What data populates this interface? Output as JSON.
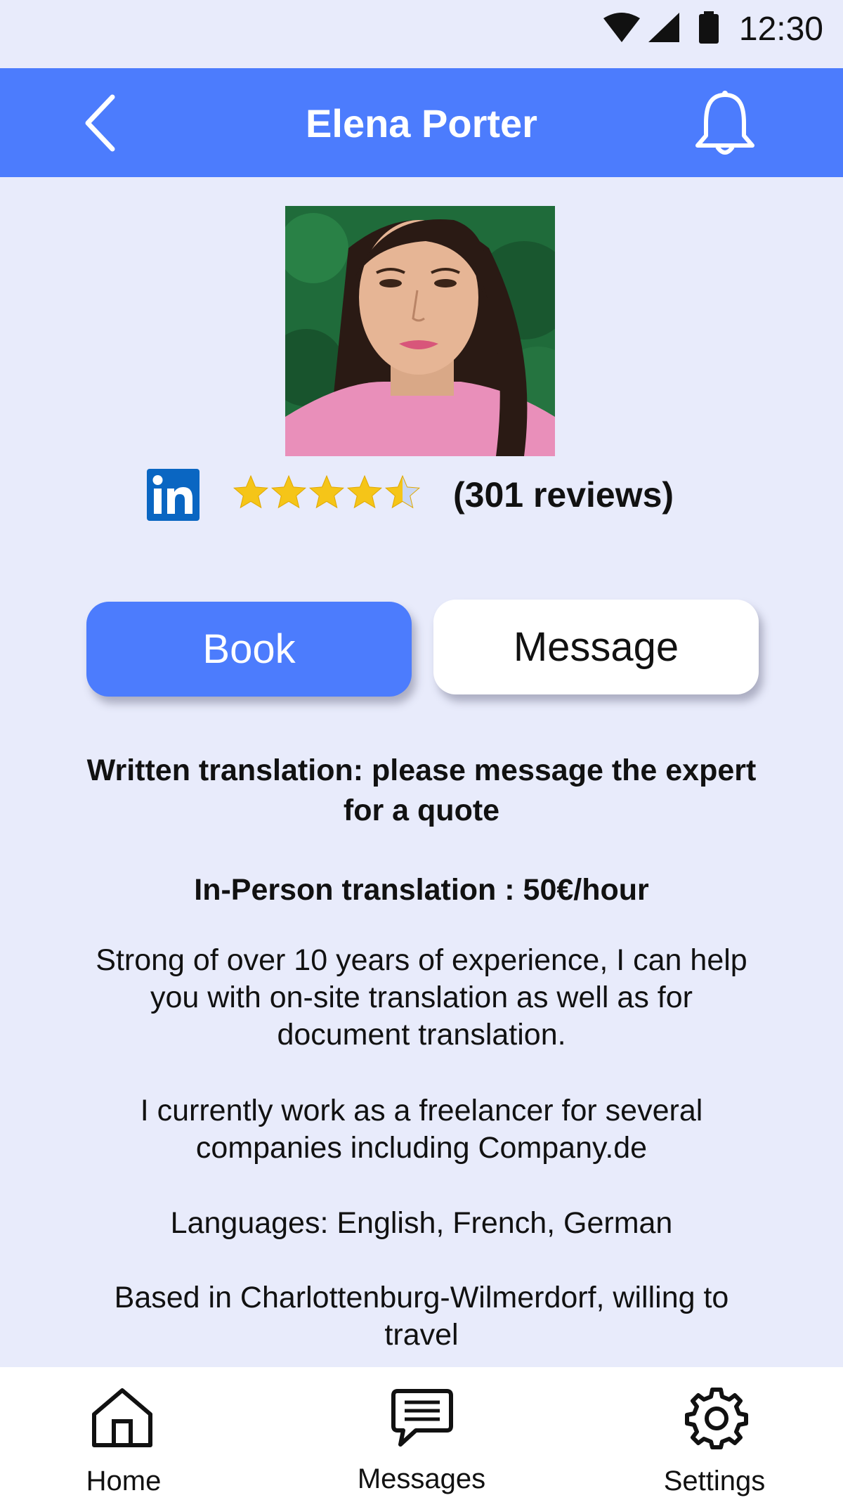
{
  "status_bar": {
    "time": "12:30",
    "icons": [
      "wifi-icon",
      "cellular-signal-icon",
      "battery-icon"
    ]
  },
  "header": {
    "title": "Elena Porter",
    "back_icon": "back-chevron-icon",
    "notification_icon": "bell-icon",
    "background_color": "#4c7cfd"
  },
  "profile": {
    "avatar": "profile-photo",
    "social_icon": "linkedin-icon",
    "rating": 4.5,
    "rating_max": 5,
    "reviews_label": "(301 reviews)"
  },
  "actions": {
    "book_label": "Book",
    "message_label": "Message"
  },
  "details": {
    "written_translation": "Written translation: please message the expert for a quote",
    "in_person_translation": "In-Person translation : 50€/hour",
    "experience": "Strong of over 10 years of experience, I can help you with on-site translation as well as for document translation.",
    "current_work": "I currently work as a freelancer for several companies including Company.de",
    "languages": "Languages: English, French, German",
    "location": "Based in Charlottenburg-Wilmerdorf, willing to travel"
  },
  "bottom_nav": {
    "items": [
      {
        "label": "Home",
        "icon": "home-icon"
      },
      {
        "label": "Messages",
        "icon": "messages-icon"
      },
      {
        "label": "Settings",
        "icon": "settings-icon"
      }
    ]
  },
  "colors": {
    "accent": "#4c7cfd",
    "page_background": "#e8ebfb",
    "star": "#f5c518"
  }
}
